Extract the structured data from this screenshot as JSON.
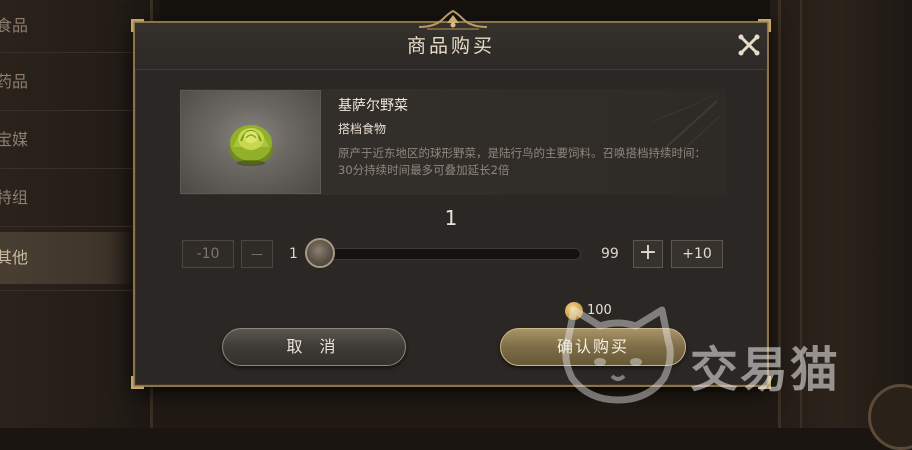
{
  "background": {
    "side_items": [
      "食品",
      "药品",
      "宝媒",
      "特组",
      "其他"
    ]
  },
  "dialog": {
    "title": "商品购买",
    "item": {
      "name": "基萨尔野菜",
      "type": "搭档食物",
      "description": "原产于近东地区的球形野菜，是陆行鸟的主要饲料。召唤搭档持续时间：30分持续时间最多可叠加延长2倍",
      "icon": "cabbage-icon"
    },
    "quantity": {
      "value": "1",
      "min_label": "1",
      "max_label": "99",
      "minus10_label": "-10",
      "minus_label": "—",
      "plus_label": "+",
      "plus10_label": "+10"
    },
    "price": {
      "amount": "100",
      "currency_icon": "gold-coin-icon"
    },
    "buttons": {
      "cancel": "取 消",
      "confirm": "确认购买"
    }
  },
  "watermark": {
    "text": "交易猫"
  },
  "colors": {
    "frame_gold": "#8a7448",
    "dialog_bg": "#2b2724",
    "confirm_gold": "#7d6c47"
  }
}
